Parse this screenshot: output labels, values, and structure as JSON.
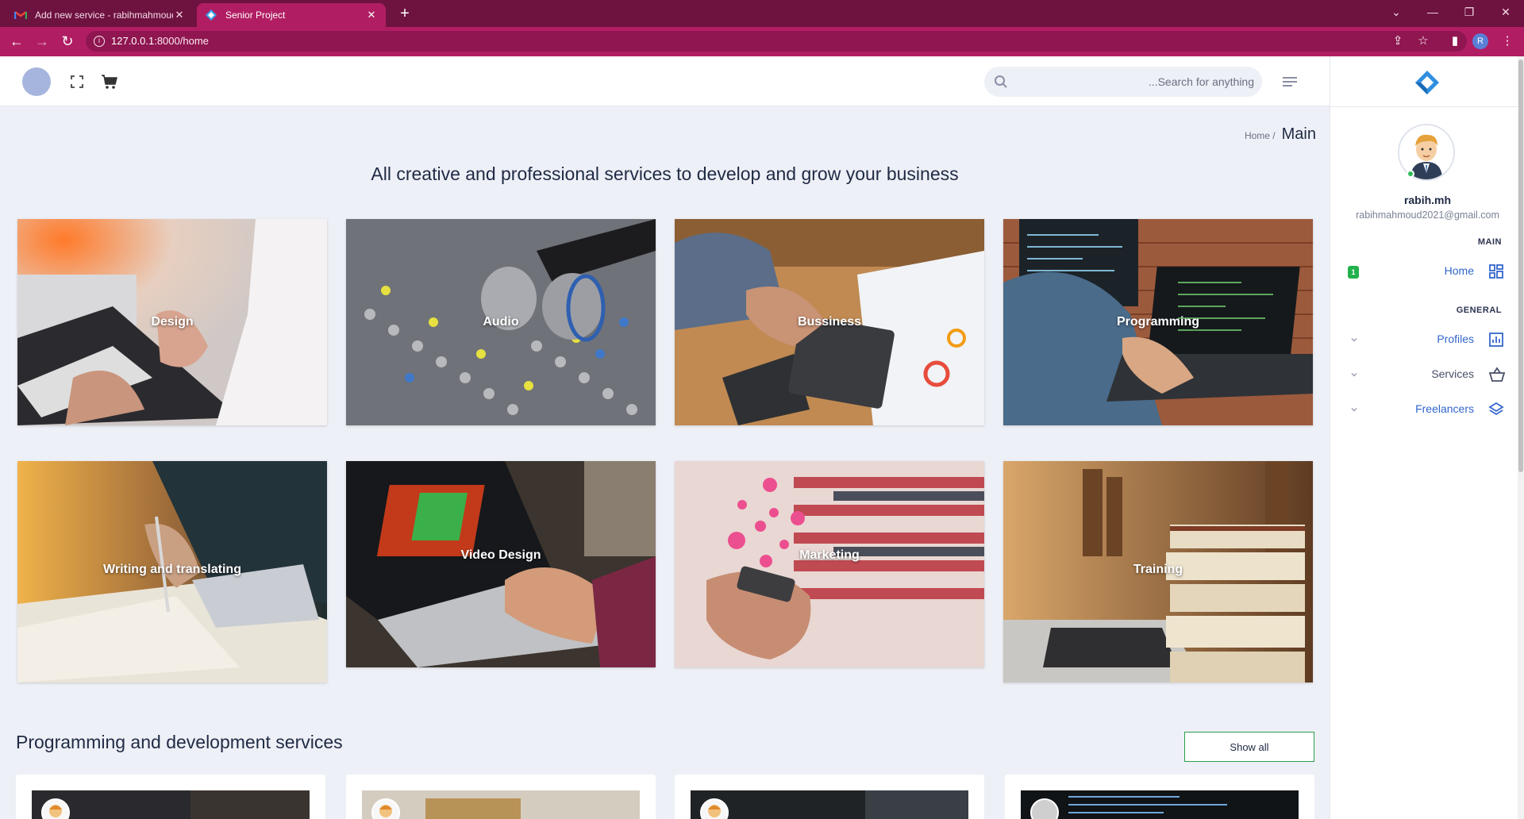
{
  "browser": {
    "tabs": [
      {
        "title": "Add new service - rabihmahmoud",
        "active": false,
        "icon": "gmail-icon"
      },
      {
        "title": "Senior Project",
        "active": true,
        "icon": "app-logo-icon"
      }
    ],
    "url_host": "127.0.0.1",
    "url_rest": ":8000/home",
    "profile_initial": "R",
    "colors": {
      "tabbar": "#6e1240",
      "toolbar": "#b11d63"
    }
  },
  "header": {
    "search_placeholder": "...Search for anything"
  },
  "breadcrumb": {
    "parent": "Home /",
    "current": "Main"
  },
  "headline": "All creative and professional services to develop and grow your business",
  "categories": [
    {
      "label": "Design",
      "icon": "design-photo"
    },
    {
      "label": "Audio",
      "icon": "audio-photo"
    },
    {
      "label": "Bussiness",
      "icon": "business-photo"
    },
    {
      "label": "Programming",
      "icon": "programming-photo"
    },
    {
      "label": "Writing and translating",
      "icon": "writing-photo"
    },
    {
      "label": "Video Design",
      "icon": "video-photo"
    },
    {
      "label": "Marketing",
      "icon": "marketing-photo"
    },
    {
      "label": "Training",
      "icon": "training-photo"
    }
  ],
  "section": {
    "title": "Programming and development services",
    "show_all": "Show all"
  },
  "sidebar": {
    "user_name": "rabih.mh",
    "user_email": "rabihmahmoud2021@gmail.com",
    "main_label": "MAIN",
    "general_label": "GENERAL",
    "home": {
      "label": "Home",
      "badge": "1"
    },
    "items": [
      {
        "label": "Profiles",
        "icon": "chart-icon"
      },
      {
        "label": "Services",
        "icon": "basket-icon"
      },
      {
        "label": "Freelancers",
        "icon": "layers-icon"
      }
    ],
    "accent": "#3366cc"
  }
}
